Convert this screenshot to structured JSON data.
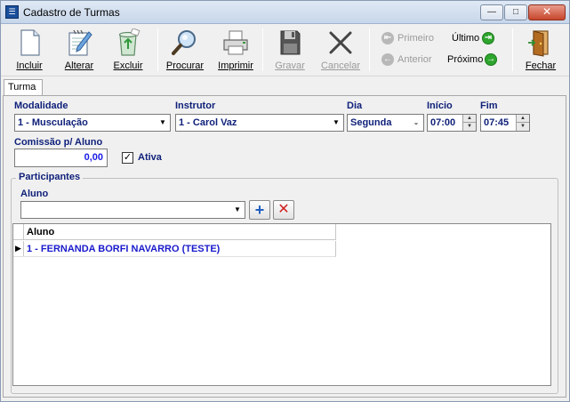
{
  "window": {
    "title": "Cadastro de Turmas"
  },
  "toolbar": {
    "incluir": "Incluir",
    "alterar": "Alterar",
    "excluir": "Excluir",
    "procurar": "Procurar",
    "imprimir": "Imprimir",
    "gravar": "Gravar",
    "cancelar": "Cancelar",
    "primeiro": "Primeiro",
    "anterior": "Anterior",
    "ultimo": "Último",
    "proximo": "Próximo",
    "fechar": "Fechar"
  },
  "tab": {
    "label": "Turma"
  },
  "form": {
    "modalidade": {
      "label": "Modalidade",
      "value": "1 - Musculação"
    },
    "instrutor": {
      "label": "Instrutor",
      "value": "1 - Carol Vaz"
    },
    "dia": {
      "label": "Dia",
      "value": "Segunda"
    },
    "inicio": {
      "label": "Início",
      "value": "07:00"
    },
    "fim": {
      "label": "Fim",
      "value": "07:45"
    },
    "comissao": {
      "label": "Comissão p/ Aluno",
      "value": "0,00"
    },
    "ativa": {
      "label": "Ativa",
      "checked": true
    }
  },
  "participantes": {
    "title": "Participantes",
    "aluno_label": "Aluno",
    "aluno_value": "",
    "grid": {
      "column": "Aluno",
      "rows": [
        "1 - FERNANDA BORFI NAVARRO (TESTE)"
      ]
    }
  },
  "colors": {
    "label": "#10217a",
    "value": "#1a1ae6",
    "enabled_nav": "#2ea52e",
    "disabled": "#9a9a9a"
  },
  "icons": {
    "incluir": "new-document-icon",
    "alterar": "edit-document-icon",
    "excluir": "recycle-bin-icon",
    "procurar": "magnifier-icon",
    "imprimir": "printer-icon",
    "gravar": "floppy-disk-icon",
    "cancelar": "x-mark-icon",
    "fechar": "door-exit-icon"
  }
}
